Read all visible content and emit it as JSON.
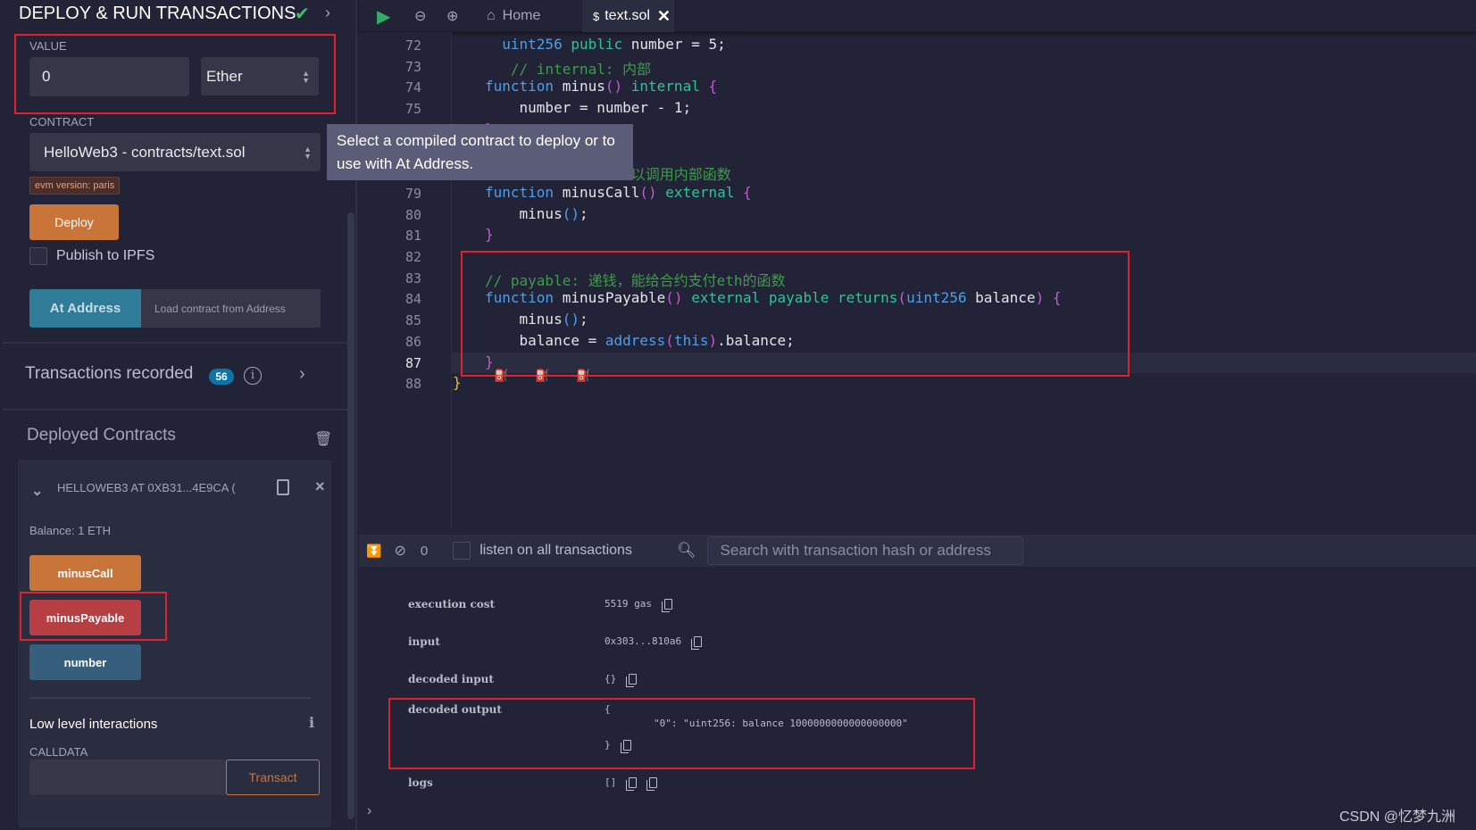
{
  "panel": {
    "title": "DEPLOY & RUN TRANSACTIONS",
    "value_label": "VALUE",
    "value": "0",
    "unit": "Ether",
    "contract_label": "CONTRACT",
    "contract": "HelloWeb3 - contracts/text.sol",
    "evm_badge": "evm version: paris",
    "deploy": "Deploy",
    "publish": "Publish to IPFS",
    "at_address": "At Address",
    "load_placeholder": "Load contract from Address",
    "tx_recorded": "Transactions recorded",
    "tx_count": "56",
    "deployed": "Deployed Contracts",
    "instance": "HELLOWEB3 AT 0XB31...4E9CA (",
    "balance": "Balance: 1 ETH",
    "functions": [
      {
        "label": "minusCall",
        "color": "#c97539"
      },
      {
        "label": "minusPayable",
        "color": "#b73e42"
      },
      {
        "label": "number",
        "color": "#355f7d"
      }
    ],
    "low_level": "Low level interactions",
    "calldata": "CALLDATA",
    "transact": "Transact"
  },
  "tooltip": "Select a compiled contract to deploy or to use with At Address.",
  "tabs": {
    "home": "Home",
    "file": "text.sol"
  },
  "editor": {
    "active_line": 87,
    "lines": [
      {
        "n": "72",
        "t": [
          [
            "  ",
            ""
          ],
          [
            "uint256",
            "kw"
          ],
          [
            " ",
            ""
          ],
          [
            "public",
            "md"
          ],
          [
            " number = 5;",
            "nm"
          ]
        ]
      },
      {
        "n": "73",
        "t": [
          [
            "   ",
            ""
          ],
          [
            "// internal: 内部",
            "cm"
          ]
        ]
      },
      {
        "n": "74",
        "t": [
          [
            "function",
            "kw"
          ],
          [
            " minus",
            ""
          ],
          [
            "()",
            "br"
          ],
          [
            " ",
            ""
          ],
          [
            "internal",
            "md"
          ],
          [
            " ",
            ""
          ],
          [
            "{",
            "br"
          ]
        ]
      },
      {
        "n": "75",
        "t": [
          [
            "    number = number - 1;",
            ""
          ]
        ]
      },
      {
        "n": "76",
        "t": [
          [
            "}",
            "br"
          ]
        ]
      },
      {
        "n": "77",
        "t": []
      },
      {
        "n": "78",
        "t": [
          [
            "                 ",
            ""
          ],
          [
            "以调用内部函数",
            "cm"
          ]
        ]
      },
      {
        "n": "79",
        "t": [
          [
            "function",
            "kw"
          ],
          [
            " minusCall",
            ""
          ],
          [
            "()",
            "br"
          ],
          [
            " ",
            ""
          ],
          [
            "external",
            "md"
          ],
          [
            " ",
            ""
          ],
          [
            "{",
            "br"
          ]
        ]
      },
      {
        "n": "80",
        "t": [
          [
            "    minus",
            ""
          ],
          [
            "()",
            "kw"
          ],
          [
            ";",
            ""
          ]
        ]
      },
      {
        "n": "81",
        "t": [
          [
            "}",
            "br"
          ]
        ]
      },
      {
        "n": "82",
        "t": []
      },
      {
        "n": "83",
        "t": [
          [
            "// payable: 递钱，能给合约支付eth的函数",
            "cm"
          ]
        ]
      },
      {
        "n": "84",
        "t": [
          [
            "function",
            "kw"
          ],
          [
            " minusPayable",
            ""
          ],
          [
            "()",
            "br"
          ],
          [
            " ",
            ""
          ],
          [
            "external",
            "md"
          ],
          [
            " ",
            ""
          ],
          [
            "payable",
            "md"
          ],
          [
            " ",
            ""
          ],
          [
            "returns",
            "md"
          ],
          [
            "(",
            "br"
          ],
          [
            "uint256",
            "kw"
          ],
          [
            " balance",
            ""
          ],
          [
            ")",
            "br"
          ],
          [
            " ",
            ""
          ],
          [
            "{",
            "br"
          ]
        ]
      },
      {
        "n": "85",
        "t": [
          [
            "    minus",
            ""
          ],
          [
            "()",
            "kw"
          ],
          [
            ";",
            ""
          ]
        ]
      },
      {
        "n": "86",
        "t": [
          [
            "    balance = ",
            ""
          ],
          [
            "address",
            "kw"
          ],
          [
            "(",
            "br"
          ],
          [
            "this",
            "kw"
          ],
          [
            ")",
            "br"
          ],
          [
            ".balance;",
            ""
          ]
        ]
      },
      {
        "n": "87",
        "t": [
          [
            "}",
            "br"
          ]
        ]
      },
      {
        "n": "88",
        "t": [
          [
            "}",
            "yl"
          ]
        ]
      }
    ]
  },
  "terminal": {
    "count": "0",
    "listen": "listen on all transactions",
    "search_placeholder": "Search with transaction hash or address",
    "rows": [
      {
        "k": "execution cost",
        "v": "5519 gas"
      },
      {
        "k": "input",
        "v": "0x303...810a6"
      },
      {
        "k": "decoded input",
        "v": "{}"
      },
      {
        "k": "decoded output",
        "v1": "{",
        "v2": "\"0\": \"uint256: balance 1000000000000000000\"",
        "v3": "}"
      },
      {
        "k": "logs",
        "v": "[]"
      }
    ]
  },
  "watermark": "CSDN @忆梦九洲"
}
